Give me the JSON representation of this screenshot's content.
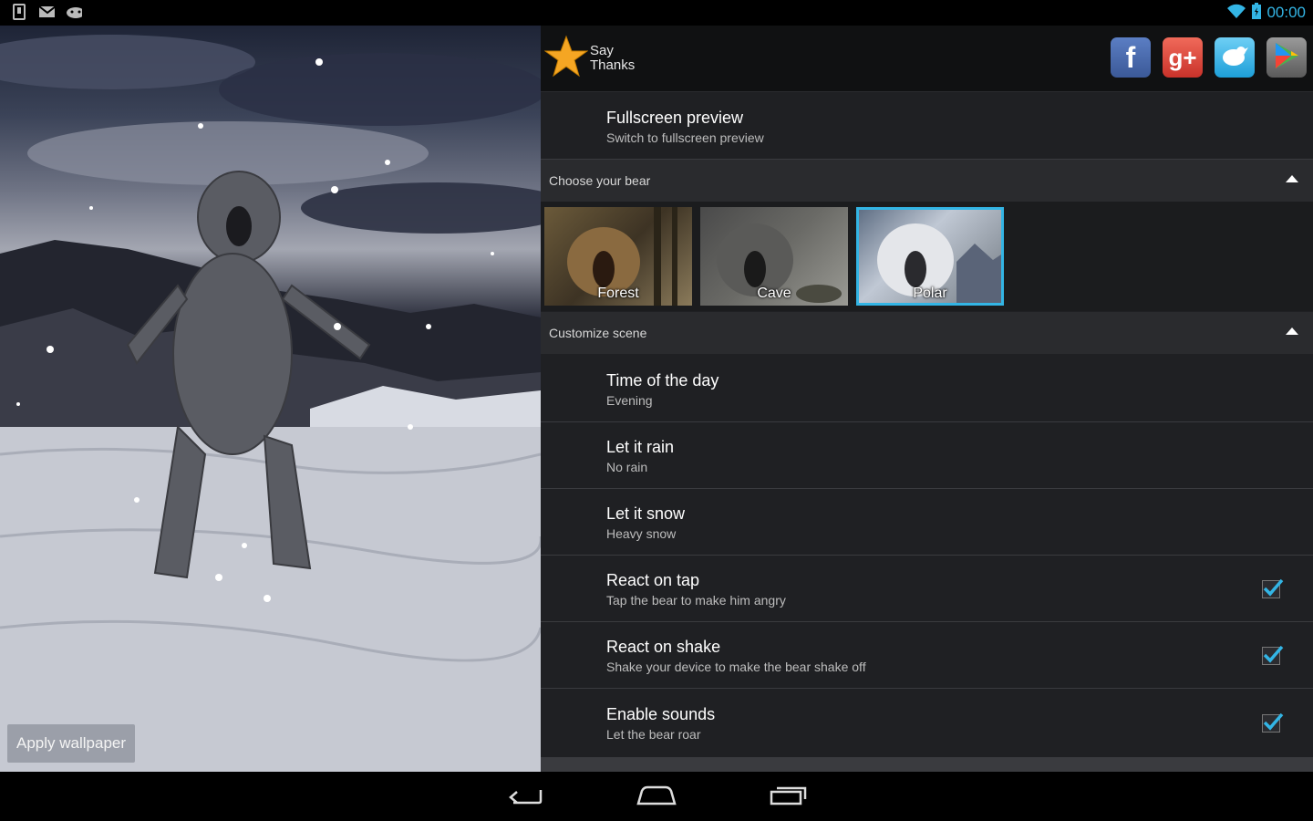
{
  "status_bar": {
    "time": "00:00",
    "left_icons": [
      "sd-card-icon",
      "gmail-icon",
      "android-icon"
    ],
    "right_icons": [
      "wifi-icon",
      "battery-icon"
    ],
    "accent_color": "#33b5e5"
  },
  "preview": {
    "apply_label": "Apply wallpaper"
  },
  "header": {
    "say_thanks_line1": "Say",
    "say_thanks_line2": "Thanks",
    "social": [
      {
        "name": "facebook",
        "icon": "facebook-icon",
        "glyph": "f",
        "color": "#3b5998"
      },
      {
        "name": "google-plus",
        "icon": "google-plus-icon",
        "glyph": "g+",
        "color": "#dd4b39"
      },
      {
        "name": "twitter",
        "icon": "twitter-icon",
        "glyph": "",
        "color": "#1da1f2"
      },
      {
        "name": "play-store",
        "icon": "play-store-icon",
        "glyph": "",
        "color": "#707070"
      }
    ]
  },
  "fullscreen": {
    "title": "Fullscreen preview",
    "subtitle": "Switch to fullscreen preview"
  },
  "choose_bear": {
    "header": "Choose your bear",
    "bears": [
      {
        "label": "Forest",
        "selected": false
      },
      {
        "label": "Cave",
        "selected": false
      },
      {
        "label": "Polar",
        "selected": true
      }
    ]
  },
  "customize": {
    "header": "Customize scene",
    "items": [
      {
        "title": "Time of the day",
        "subtitle": "Evening",
        "has_checkbox": false
      },
      {
        "title": "Let it rain",
        "subtitle": "No rain",
        "has_checkbox": false
      },
      {
        "title": "Let it snow",
        "subtitle": "Heavy snow",
        "has_checkbox": false
      },
      {
        "title": "React on tap",
        "subtitle": "Tap the bear to make him angry",
        "has_checkbox": true,
        "checked": true
      },
      {
        "title": "React on shake",
        "subtitle": "Shake your device to make the bear shake off",
        "has_checkbox": true,
        "checked": true
      },
      {
        "title": "Enable sounds",
        "subtitle": "Let the bear roar",
        "has_checkbox": true,
        "checked": true
      }
    ]
  },
  "nav": {
    "icons": [
      "back-icon",
      "home-icon",
      "recent-apps-icon"
    ]
  }
}
